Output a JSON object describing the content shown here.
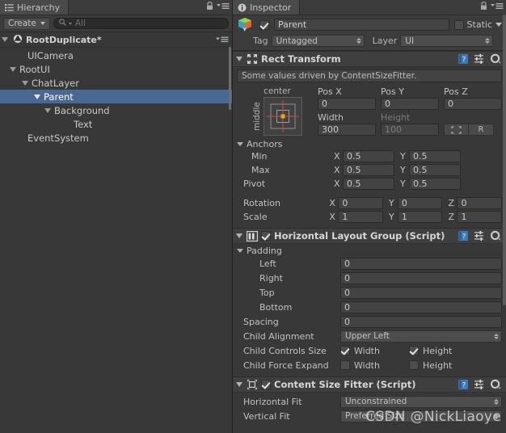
{
  "hierarchy": {
    "tab_label": "Hierarchy",
    "tab_icon": "hierarchy-icon",
    "lock_icon": "lock-icon",
    "menu_icon": "hamburger-menu-icon",
    "create_label": "Create",
    "search_placeholder": "All",
    "search_icon": "search-icon",
    "scene_name": "RootDuplicate*",
    "items": [
      {
        "label": "UICamera",
        "depth": 1,
        "expandable": false,
        "selected": false
      },
      {
        "label": "RootUI",
        "depth": 1,
        "expandable": true,
        "selected": false
      },
      {
        "label": "ChatLayer",
        "depth": 2,
        "expandable": true,
        "selected": false
      },
      {
        "label": "Parent",
        "depth": 3,
        "expandable": true,
        "selected": true
      },
      {
        "label": "Background",
        "depth": 4,
        "expandable": true,
        "selected": false
      },
      {
        "label": "Text",
        "depth": 5,
        "expandable": false,
        "selected": false
      },
      {
        "label": "EventSystem",
        "depth": 1,
        "expandable": false,
        "selected": false
      }
    ],
    "selection_color": "#4a6894"
  },
  "inspector": {
    "tab_label": "Inspector",
    "tab_icon": "info-icon",
    "lock_icon": "lock-icon",
    "menu_icon": "hamburger-menu-icon",
    "object": {
      "enabled": true,
      "name": "Parent",
      "icon": "prefab-cube-icon",
      "static_label": "Static",
      "static_checked": false,
      "tag_label": "Tag",
      "tag_value": "Untagged",
      "layer_label": "Layer",
      "layer_value": "UI"
    },
    "components": [
      {
        "id": "rect-transform",
        "title": "Rect Transform",
        "icon": "rect-transform-icon",
        "has_checkbox": false,
        "expanded": true,
        "help_icon": "help-book-icon",
        "preset_icon": "preset-icon",
        "gear_icon": "gear-icon",
        "info_text": "Some values driven by ContentSizeFitter.",
        "anchor_preset": {
          "top_label": "center",
          "left_label": "middle"
        },
        "pos": [
          {
            "cap": "Pos X",
            "value": "0",
            "dim": false
          },
          {
            "cap": "Pos Y",
            "value": "0",
            "dim": false
          },
          {
            "cap": "Pos Z",
            "value": "0",
            "dim": false
          }
        ],
        "size": [
          {
            "cap": "Width",
            "value": "300",
            "dim": false
          },
          {
            "cap": "Height",
            "value": "100",
            "dim": true
          }
        ],
        "blueprint_button": "blueprint-mode-icon",
        "raw_button": "R",
        "anchors_label": "Anchors",
        "vec2_rows": [
          {
            "label": "Min",
            "indent": 1,
            "x": "0.5",
            "y": "0.5"
          },
          {
            "label": "Max",
            "indent": 1,
            "x": "0.5",
            "y": "0.5"
          },
          {
            "label": "Pivot",
            "indent": 0,
            "x": "0.5",
            "y": "0.5"
          }
        ],
        "vec3_rows": [
          {
            "label": "Rotation",
            "indent": 0,
            "x": "0",
            "y": "0",
            "z": "0"
          },
          {
            "label": "Scale",
            "indent": 0,
            "x": "1",
            "y": "1",
            "z": "1"
          }
        ],
        "axis_x": "X",
        "axis_y": "Y",
        "axis_z": "Z"
      },
      {
        "id": "horizontal-layout-group",
        "title": "Horizontal Layout Group (Script)",
        "icon": "layout-group-icon",
        "has_checkbox": true,
        "checked": true,
        "expanded": true,
        "help_icon": "help-book-icon",
        "preset_icon": "preset-icon",
        "gear_icon": "gear-icon",
        "padding_label": "Padding",
        "padding_rows": [
          {
            "label": "Left",
            "value": "0"
          },
          {
            "label": "Right",
            "value": "0"
          },
          {
            "label": "Top",
            "value": "0"
          },
          {
            "label": "Bottom",
            "value": "0"
          }
        ],
        "spacing_label": "Spacing",
        "spacing_value": "0",
        "child_alignment_label": "Child Alignment",
        "child_alignment_value": "Upper Left",
        "child_controls_label": "Child Controls Size",
        "child_controls_width_label": "Width",
        "child_controls_width": true,
        "child_controls_height_label": "Height",
        "child_controls_height": true,
        "child_force_label": "Child Force Expand",
        "child_force_width_label": "Width",
        "child_force_width": false,
        "child_force_height_label": "Height",
        "child_force_height": false
      },
      {
        "id": "content-size-fitter",
        "title": "Content Size Fitter (Script)",
        "icon": "content-size-fitter-icon",
        "has_checkbox": true,
        "checked": true,
        "expanded": true,
        "help_icon": "help-book-icon",
        "preset_icon": "preset-icon",
        "gear_icon": "gear-icon",
        "horizontal_fit_label": "Horizontal Fit",
        "horizontal_fit_value": "Unconstrained",
        "vertical_fit_label": "Vertical Fit",
        "vertical_fit_value": "Preferred Size"
      }
    ]
  },
  "watermark": "CSDN @NickLiaoye",
  "theme": {
    "panel_bg": "#383838",
    "header_bg": "#3c3c3c",
    "field_bg": "#434343",
    "accent_blue": "#4a6894",
    "text": "#c2c2c2"
  }
}
